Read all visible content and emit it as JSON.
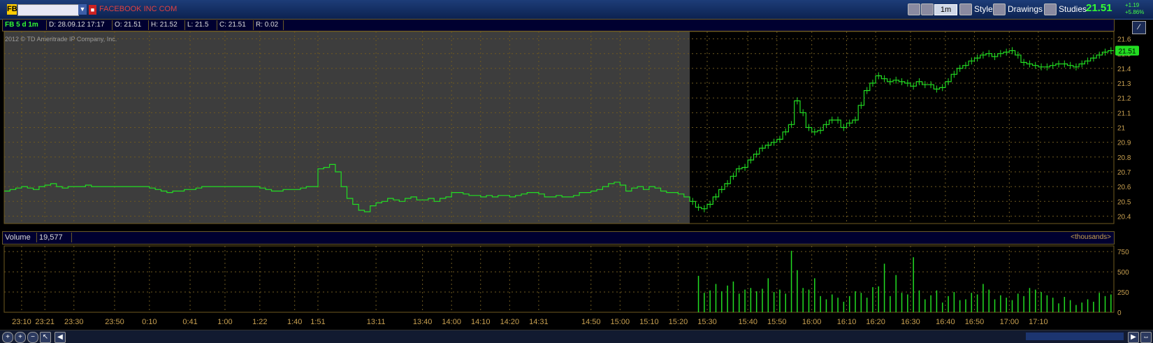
{
  "toolbar": {
    "symbol_badge": "FB",
    "company": "FACEBOOK INC COM",
    "interval": "1m",
    "style_label": "Style",
    "drawings_label": "Drawings",
    "studies_label": "Studies",
    "last_price": "21.51",
    "change_net": "+1.19",
    "change_pct": "+5.86%"
  },
  "infobar": {
    "cell_symbol": "FB 5 d 1m",
    "cell_date": "D: 28.09.12 17:17",
    "cell_open": "O: 21.51",
    "cell_high": "H: 21.52",
    "cell_low": "L: 21.5",
    "cell_close": "C: 21.51",
    "cell_range": "R: 0.02"
  },
  "copyright": "2012 © TD Ameritrade IP Company, Inc.",
  "volume_header": {
    "label": "Volume",
    "value": "19,577",
    "unit": "<thousands>"
  },
  "colors": {
    "price_line": "#22dd22",
    "previous_session_bg": "#3d3d3d",
    "grid": "#6f5a20",
    "axis_text": "#c8a050",
    "price_tag": "#22dd22"
  },
  "chart_data": [
    {
      "type": "line",
      "ylim": [
        20.35,
        21.65
      ],
      "yticks": [
        20.4,
        20.5,
        20.6,
        20.7,
        20.8,
        20.9,
        21.0,
        21.1,
        21.2,
        21.3,
        21.4,
        21.5,
        21.6
      ],
      "ytick_labels": [
        "20.4",
        "20.5",
        "20.6",
        "20.7",
        "20.8",
        "20.9",
        "21",
        "21.1",
        "21.2",
        "21.3",
        "21.4",
        "21.5",
        "21.6"
      ],
      "price_tag": "21.51",
      "x_tick_labels": [
        "23:10",
        "23:21",
        "23:30",
        "23:50",
        "0:10",
        "0:41",
        "1:00",
        "1:22",
        "1:40",
        "1:51",
        "13:11",
        "13:40",
        "14:00",
        "14:10",
        "14:20",
        "14:31",
        "14:50",
        "15:00",
        "15:10",
        "15:20",
        "15:30",
        "15:40",
        "15:50",
        "16:00",
        "16:10",
        "16:20",
        "16:30",
        "16:40",
        "16:50",
        "17:00",
        "17:10"
      ],
      "x_tick_index": [
        3,
        7,
        12,
        19,
        25,
        32,
        38,
        44,
        50,
        54,
        64,
        72,
        77,
        82,
        87,
        92,
        101,
        106,
        111,
        116,
        121,
        128,
        133,
        139,
        145,
        150,
        156,
        162,
        167,
        173,
        178
      ],
      "series": [
        {
          "values": [
            20.57,
            20.58,
            20.59,
            20.6,
            20.59,
            20.58,
            20.6,
            20.61,
            20.62,
            20.6,
            20.59,
            20.6,
            20.6,
            20.6,
            20.61,
            20.6,
            20.6,
            20.6,
            20.6,
            20.6,
            20.6,
            20.6,
            20.6,
            20.6,
            20.6,
            20.59,
            20.58,
            20.57,
            20.56,
            20.57,
            20.57,
            20.58,
            20.58,
            20.59,
            20.6,
            20.6,
            20.6,
            20.6,
            20.6,
            20.6,
            20.6,
            20.6,
            20.6,
            20.6,
            20.59,
            20.58,
            20.57,
            20.57,
            20.58,
            20.58,
            20.58,
            20.59,
            20.6,
            20.6,
            20.72,
            20.73,
            20.75,
            20.7,
            20.6,
            20.52,
            20.48,
            20.44,
            20.43,
            20.47,
            20.49,
            20.5,
            20.52,
            20.51,
            20.5,
            20.52,
            20.53,
            20.51,
            20.51,
            20.52,
            20.5,
            20.52,
            20.53,
            20.56,
            20.56,
            20.55,
            20.54,
            20.54,
            20.53,
            20.54,
            20.53,
            20.54,
            20.54,
            20.53,
            20.54,
            20.55,
            20.56,
            20.56,
            20.55,
            20.53,
            20.53,
            20.54,
            20.53,
            20.53,
            20.54,
            20.56,
            20.56,
            20.57,
            20.58,
            20.6,
            20.62,
            20.63,
            20.61,
            20.57,
            20.59,
            20.6,
            20.58,
            20.6,
            20.59,
            20.57,
            20.56,
            20.56,
            20.55,
            20.53,
            20.5,
            20.46,
            20.45,
            20.48,
            20.53,
            20.58,
            20.62,
            20.67,
            20.72,
            20.73,
            20.78,
            20.82,
            20.86,
            20.88,
            20.9,
            20.92,
            20.97,
            21.02,
            21.18,
            21.1,
            21.0,
            20.97,
            20.98,
            21.02,
            21.05,
            21.05,
            21.0,
            21.03,
            21.05,
            21.15,
            21.25,
            21.3,
            21.35,
            21.33,
            21.31,
            21.32,
            21.31,
            21.3,
            21.28,
            21.31,
            21.29,
            21.29,
            21.26,
            21.27,
            21.31,
            21.36,
            21.4,
            21.42,
            21.45,
            21.47,
            21.49,
            21.5,
            21.48,
            21.5,
            21.51,
            21.52,
            21.49,
            21.44,
            21.43,
            21.42,
            21.41,
            21.41,
            21.42,
            21.43,
            21.43,
            21.42,
            21.41,
            21.43,
            21.45,
            21.47,
            21.49,
            21.51,
            21.52
          ]
        }
      ]
    },
    {
      "type": "bar",
      "ylim": [
        0,
        820
      ],
      "yticks": [
        0,
        250,
        500,
        750
      ],
      "ytick_labels": [
        "0",
        "250",
        "500",
        "750"
      ],
      "ylabel": "<thousands>",
      "series": [
        {
          "values": [
            0,
            0,
            0,
            0,
            0,
            0,
            0,
            0,
            0,
            0,
            0,
            0,
            0,
            0,
            0,
            0,
            0,
            0,
            0,
            0,
            0,
            0,
            0,
            0,
            0,
            0,
            0,
            0,
            0,
            0,
            0,
            0,
            0,
            0,
            0,
            0,
            0,
            0,
            0,
            0,
            0,
            0,
            0,
            0,
            0,
            0,
            0,
            0,
            0,
            0,
            0,
            0,
            0,
            0,
            0,
            0,
            0,
            0,
            0,
            0,
            0,
            0,
            0,
            0,
            0,
            0,
            0,
            0,
            0,
            0,
            0,
            0,
            0,
            0,
            0,
            0,
            0,
            0,
            0,
            0,
            0,
            0,
            0,
            0,
            0,
            0,
            0,
            0,
            0,
            0,
            0,
            0,
            0,
            0,
            0,
            0,
            0,
            0,
            0,
            0,
            0,
            0,
            0,
            0,
            0,
            0,
            0,
            0,
            0,
            0,
            0,
            0,
            0,
            0,
            0,
            0,
            0,
            0,
            0,
            450,
            240,
            270,
            350,
            260,
            330,
            380,
            230,
            280,
            300,
            260,
            290,
            420,
            250,
            280,
            230,
            760,
            520,
            300,
            280,
            420,
            200,
            160,
            220,
            180,
            130,
            200,
            260,
            240,
            180,
            310,
            320,
            600,
            200,
            460,
            240,
            220,
            680,
            270,
            160,
            210,
            270,
            120,
            200,
            250,
            150,
            160,
            240,
            220,
            350,
            280,
            160,
            210,
            180,
            150,
            230,
            200,
            300,
            280,
            250,
            210,
            180,
            110,
            190,
            150,
            90,
            120,
            160,
            130,
            240,
            200,
            220,
            270,
            260
          ]
        }
      ]
    }
  ]
}
